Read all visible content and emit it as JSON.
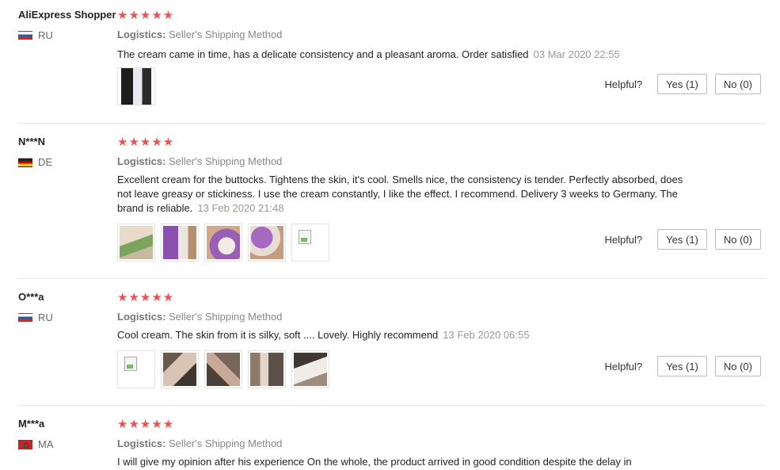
{
  "logistics_label": "Logistics:",
  "helpful_label": "Helpful?",
  "colors": {
    "star": "#f0504f",
    "date": "#999999"
  },
  "reviews": [
    {
      "user": "AliExpress Shopper",
      "country": "RU",
      "stars": "★★★★★",
      "logistics": "Seller's Shipping Method",
      "text": "The cream came in time, has a delicate consistency and a pleasant aroma. Order satisfied",
      "date": "03 Mar 2020 22:55",
      "yes": "Yes (1)",
      "no": "No (0)"
    },
    {
      "user": "N***N",
      "country": "DE",
      "stars": "★★★★★",
      "logistics": "Seller's Shipping Method",
      "text": "Excellent cream for the buttocks. Tightens the skin, it's cool. Smells nice, the consistency is tender. Perfectly absorbed, does not leave greasy or stickiness. I use the cream constantly, I like the effect. I recommend. Delivery 3 weeks to Germany. The brand is reliable.",
      "date": "13 Feb 2020 21:48",
      "yes": "Yes (1)",
      "no": "No (0)"
    },
    {
      "user": "O***a",
      "country": "RU",
      "stars": "★★★★★",
      "logistics": "Seller's Shipping Method",
      "text": "Cool cream. The skin from it is silky, soft .... Lovely. Highly recommend",
      "date": "13 Feb 2020 06:55",
      "yes": "Yes (1)",
      "no": "No (0)"
    },
    {
      "user": "M***a",
      "country": "MA",
      "stars": "★★★★★",
      "logistics": "Seller's Shipping Method",
      "text": "I will give my opinion after his experience On the whole, the product arrived in good condition despite the delay in"
    }
  ]
}
